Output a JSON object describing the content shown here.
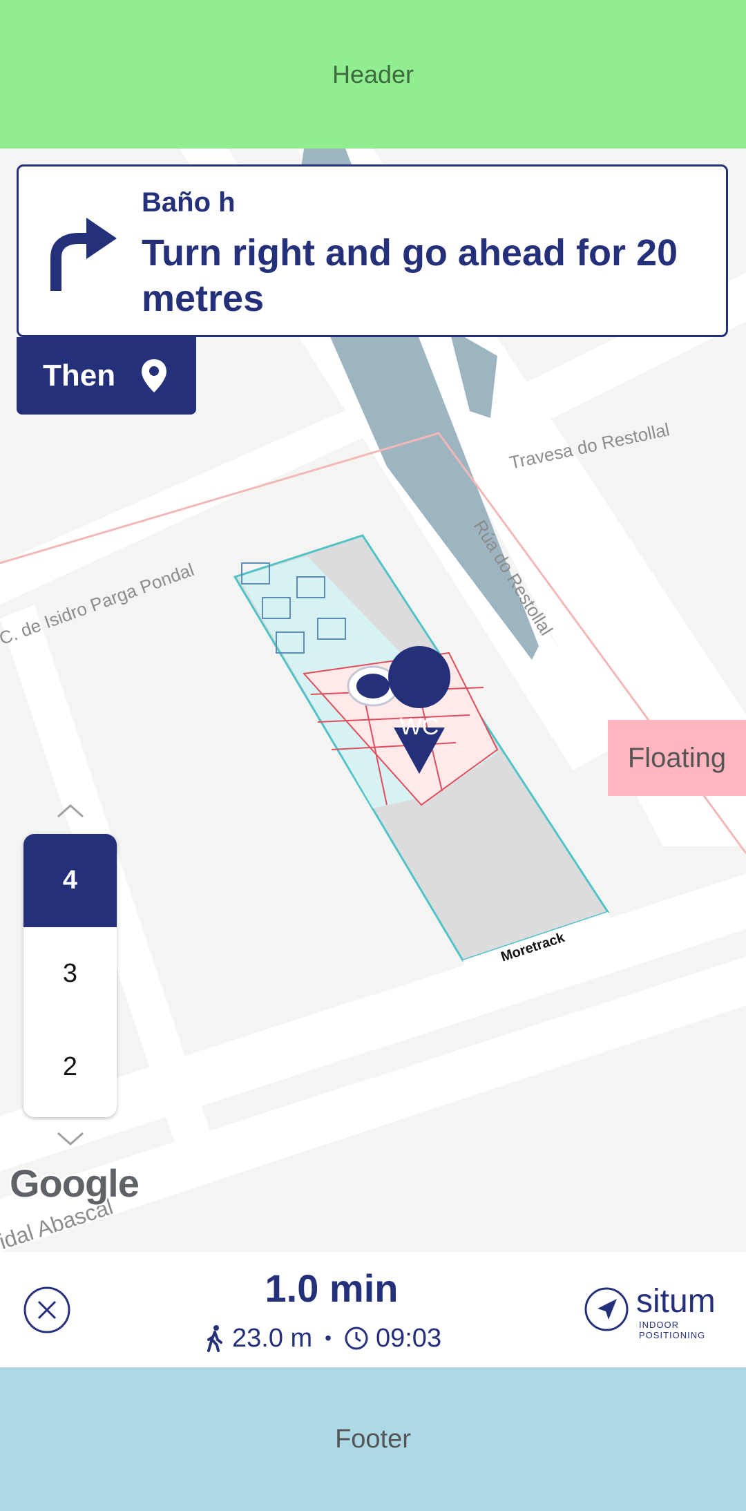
{
  "header": {
    "label": "Header"
  },
  "instruction": {
    "destination": "Baño h",
    "text": "Turn right and go ahead for 20 metres",
    "icon": "turn-right-icon"
  },
  "next": {
    "label": "Then",
    "icon": "location-pin-icon"
  },
  "map": {
    "streets": [
      "Travesa do Restollal",
      "Rúa do Restollal",
      "C. de Isidro Parga Pondal",
      "idal Abascal"
    ],
    "poi_label": "WC",
    "floorplan_label": "Moretrack",
    "attribution": "Google"
  },
  "floors": {
    "items": [
      "4",
      "3",
      "2"
    ],
    "selected": "4"
  },
  "floating": {
    "label": "Floating"
  },
  "route": {
    "eta": "1.0 min",
    "distance": "23.0 m",
    "separator": "•",
    "arrival": "09:03"
  },
  "brand": {
    "name": "situm",
    "tagline": "INDOOR POSITIONING"
  },
  "footer": {
    "label": "Footer"
  },
  "colors": {
    "primary": "#24307a",
    "header": "#90ee90",
    "footer": "#add8e6",
    "floating": "#ffb6c1"
  }
}
